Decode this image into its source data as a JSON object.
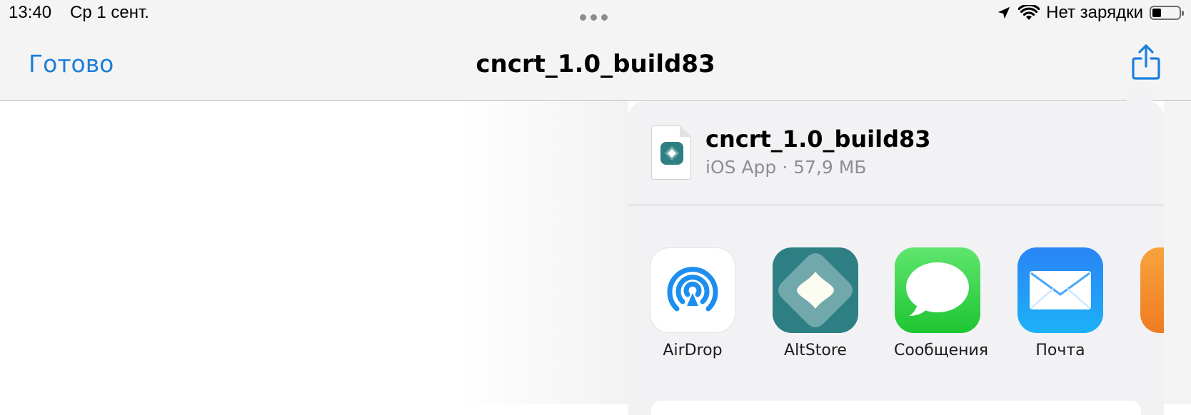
{
  "status_bar": {
    "time": "13:40",
    "date": "Ср 1 сент.",
    "charging": "Нет зарядки",
    "icons": [
      "location-arrow-icon",
      "wifi-icon",
      "battery-icon"
    ]
  },
  "nav_bar": {
    "done_label": "Готово",
    "title": "cncrt_1.0_build83",
    "share_icon": "share-icon"
  },
  "share_sheet": {
    "file_name": "cncrt_1.0_build83",
    "file_meta": "iOS App · 57,9 МБ",
    "apps": [
      {
        "label": "AirDrop",
        "icon": "airdrop-icon"
      },
      {
        "label": "AltStore",
        "icon": "altstore-icon"
      },
      {
        "label": "Сообщения",
        "icon": "messages-icon"
      },
      {
        "label": "Почта",
        "icon": "mail-icon"
      }
    ]
  },
  "colors": {
    "accent": "#1b7ddc",
    "altstore": "#2d7f84",
    "messages": "#1ec532",
    "mail": "#2a84f6"
  }
}
